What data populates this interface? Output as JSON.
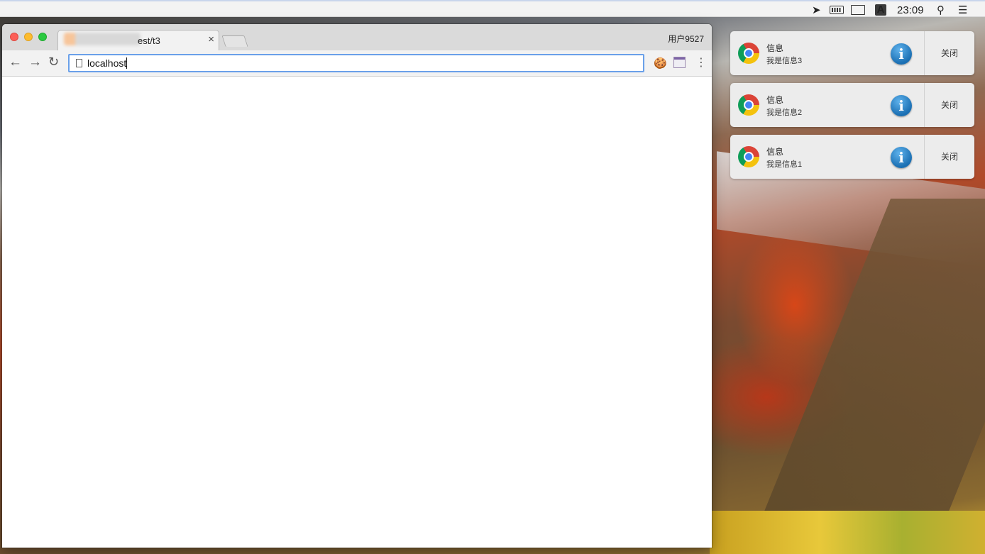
{
  "menubar": {
    "icons": [
      "send-icon",
      "battery-icon",
      "display-mirror-icon",
      "input-source-icon",
      "search-icon",
      "list-icon"
    ],
    "input_source": "A",
    "clock": "23:09"
  },
  "browser": {
    "tab_title": "est/t3",
    "tab_close": "×",
    "profile": "用户9527",
    "url": "localhost",
    "nav": {
      "back": "←",
      "forward": "→",
      "reload": "↻"
    },
    "menu": "⋮"
  },
  "notifications": [
    {
      "title": "信息",
      "body": "我是信息3",
      "close": "关闭"
    },
    {
      "title": "信息",
      "body": "我是信息2",
      "close": "关闭"
    },
    {
      "title": "信息",
      "body": "我是信息1",
      "close": "关闭"
    }
  ],
  "colors": {
    "omnibox_focus": "#6aa0e9",
    "menubar_bg": "#f3f3f3",
    "notification_bg": "#ececec",
    "info_icon": "#1a6fb3"
  }
}
